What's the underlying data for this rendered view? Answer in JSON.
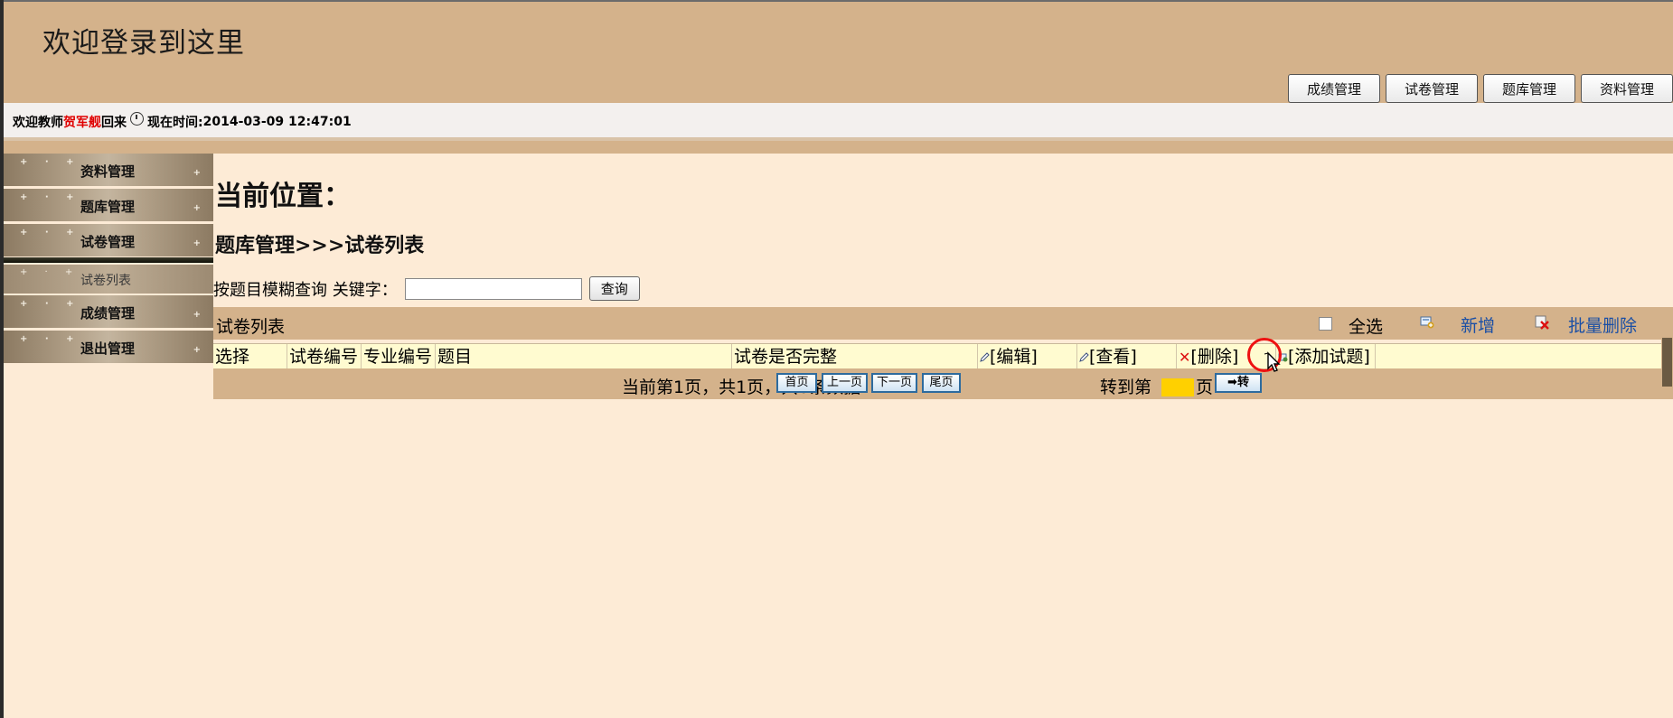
{
  "header": {
    "site_title": "欢迎登录到这里",
    "nav": [
      "成绩管理",
      "试卷管理",
      "题库管理",
      "资料管理"
    ]
  },
  "welcome": {
    "prefix": "欢迎教师",
    "teacher_name": "贺军舰",
    "suffix": "回来",
    "time_label": "现在时间:",
    "time_value": "2014-03-09 12:47:01"
  },
  "sidebar": {
    "items": [
      {
        "label": "资料管理"
      },
      {
        "label": "题库管理"
      },
      {
        "label": "试卷管理"
      },
      {
        "label": "试卷列表"
      },
      {
        "label": "成绩管理"
      },
      {
        "label": "退出管理"
      }
    ]
  },
  "main": {
    "location_title": "当前位置：",
    "breadcrumb": "题库管理>>>试卷列表",
    "search_label": "按题目模糊查询 关键字：",
    "search_value": "",
    "search_button": "查询",
    "list_title": "试卷列表",
    "select_all": "全选",
    "add_label": "新增",
    "batch_delete": "批量删除",
    "columns": [
      "选择",
      "试卷编号",
      "专业编号",
      "题目",
      "试卷是否完整",
      "[编辑]",
      "[查看]",
      "[删除]",
      "[添加试题]"
    ],
    "pager": {
      "info": "当前第1页，共1页，共0条数据",
      "first": "首页",
      "prev": "上一页",
      "next": "下一页",
      "last": "尾页",
      "goto_label": "转到第",
      "page_suffix": "页",
      "go_button": "➡转"
    }
  }
}
